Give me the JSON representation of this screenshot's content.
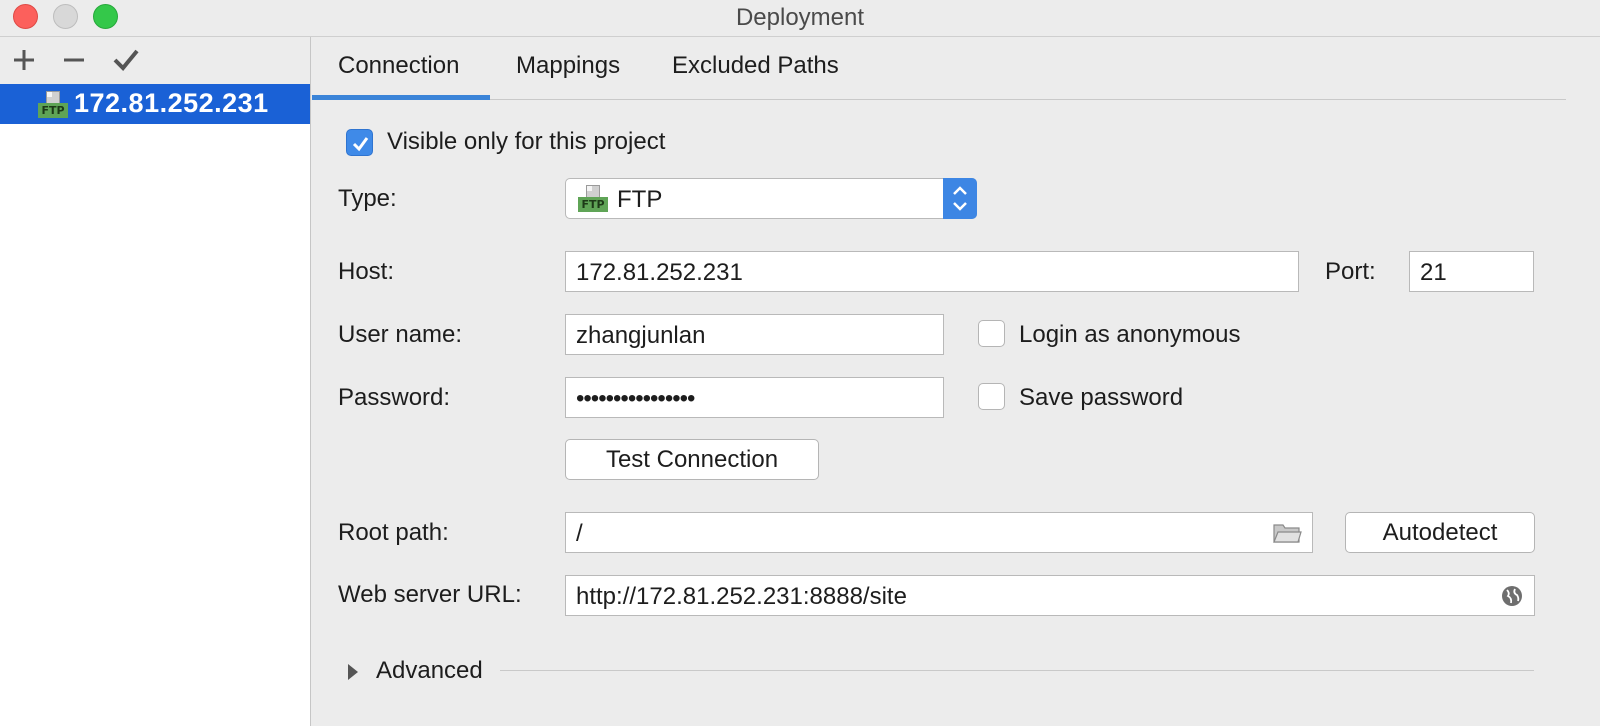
{
  "window": {
    "title": "Deployment"
  },
  "sidebar": {
    "toolbar": {
      "add": "+",
      "remove": "−",
      "apply": "✔"
    },
    "servers": [
      {
        "label": "172.81.252.231",
        "icon": "ftp-server-icon",
        "selected": true
      }
    ]
  },
  "tabs": [
    {
      "label": "Connection",
      "active": true
    },
    {
      "label": "Mappings",
      "active": false
    },
    {
      "label": "Excluded Paths",
      "active": false
    }
  ],
  "connection": {
    "visible_only": {
      "label": "Visible only for this project",
      "checked": true
    },
    "type": {
      "label": "Type:",
      "value": "FTP",
      "icon_text": "FTP"
    },
    "host": {
      "label": "Host:",
      "value": "172.81.252.231"
    },
    "port": {
      "label": "Port:",
      "value": "21"
    },
    "username": {
      "label": "User name:",
      "value": "zhangjunlan"
    },
    "anonymous": {
      "label": "Login as anonymous",
      "checked": false
    },
    "password": {
      "label": "Password:",
      "value": "••••••••••••••••"
    },
    "save_password": {
      "label": "Save password",
      "checked": false
    },
    "test_connection": "Test Connection",
    "root_path": {
      "label": "Root path:",
      "value": "/"
    },
    "autodetect": "Autodetect",
    "web_url": {
      "label": "Web server URL:",
      "value": "http://172.81.252.231:8888/site"
    },
    "advanced": "Advanced"
  },
  "colors": {
    "selection": "#1a61d6",
    "accent": "#3b84d8",
    "ftp_tag": "#5fa456"
  }
}
